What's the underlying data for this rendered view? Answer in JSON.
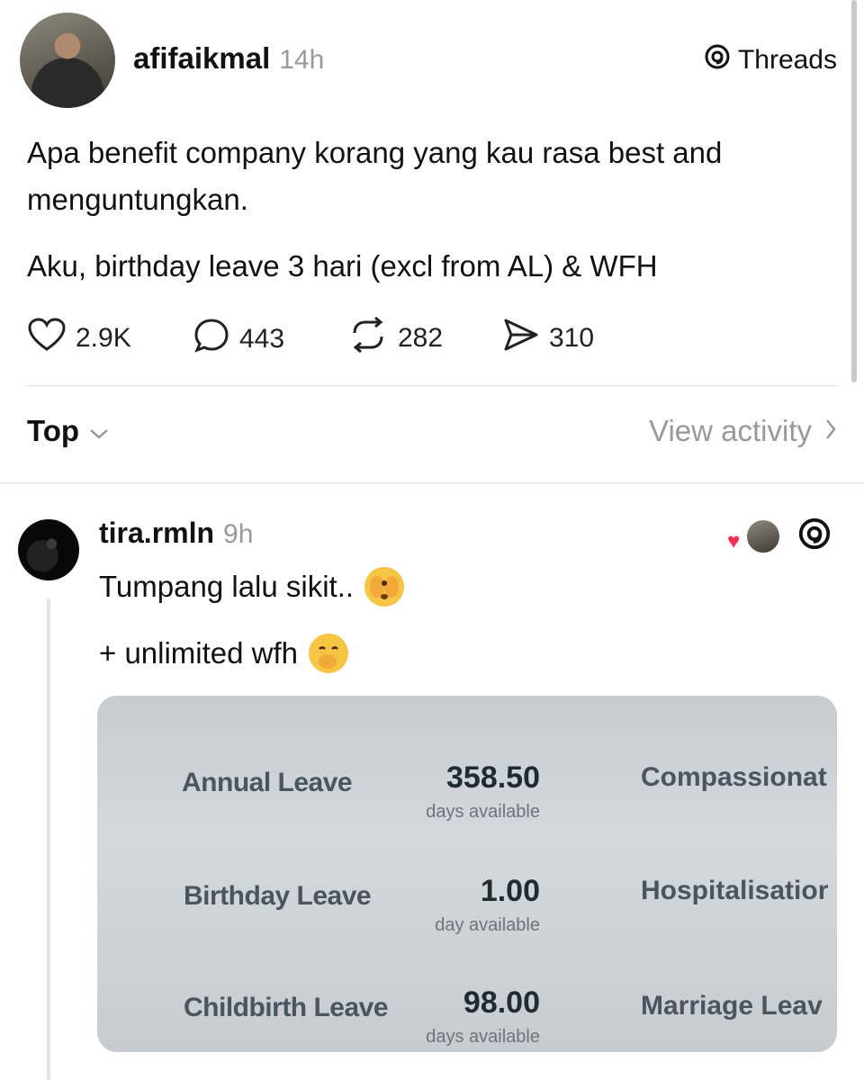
{
  "post": {
    "username": "afifaikmal",
    "time": "14h",
    "brand": "Threads",
    "text_line1": "Apa benefit company korang yang kau rasa best and",
    "text_line2": "menguntungkan.",
    "text_line3": "Aku, birthday leave 3 hari (excl from AL) & WFH",
    "likes": "2.9K",
    "comments": "443",
    "reposts": "282",
    "shares": "310"
  },
  "filter": {
    "sort_label": "Top",
    "view_activity": "View activity"
  },
  "reply": {
    "username": "tira.rmln",
    "time": "9h",
    "line1": "Tumpang lalu sikit..",
    "line2": "+ unlimited wfh"
  },
  "photo": {
    "rows": [
      {
        "label": "Annual Leave",
        "value": "358.50",
        "sub": "days available",
        "right": "Compassionat"
      },
      {
        "label": "Birthday Leave",
        "value": "1.00",
        "sub": "day available",
        "right": "Hospitalisatior"
      },
      {
        "label": "Childbirth Leave",
        "value": "98.00",
        "sub": "days available",
        "right": "Marriage Leav"
      }
    ]
  },
  "colors": {
    "like_badge": "#ff2a4f",
    "muted": "#999999",
    "emoji": "#f6c544"
  }
}
